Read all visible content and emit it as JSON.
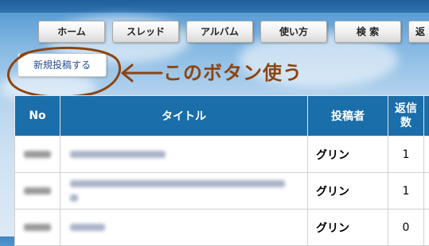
{
  "nav": {
    "items": [
      {
        "label": "ホーム"
      },
      {
        "label": "スレッド"
      },
      {
        "label": "アルバム"
      },
      {
        "label": "使い方"
      },
      {
        "label": "検 索"
      },
      {
        "label": "返"
      }
    ]
  },
  "new_post_button": {
    "label": "新規投稿する"
  },
  "annotation": {
    "text": "このボタン使う",
    "color": "#8b4513"
  },
  "table": {
    "headers": {
      "no": "No",
      "title": "タイトル",
      "author": "投稿者",
      "replies_line1": "返信",
      "replies_line2": "数"
    },
    "rows": [
      {
        "author": "グリン",
        "replies": "1"
      },
      {
        "author": "グリン",
        "replies": "1"
      },
      {
        "author": "グリン",
        "replies": "0"
      }
    ]
  },
  "colors": {
    "header_bg": "#1a6ea9",
    "link": "#1f4e8c"
  }
}
